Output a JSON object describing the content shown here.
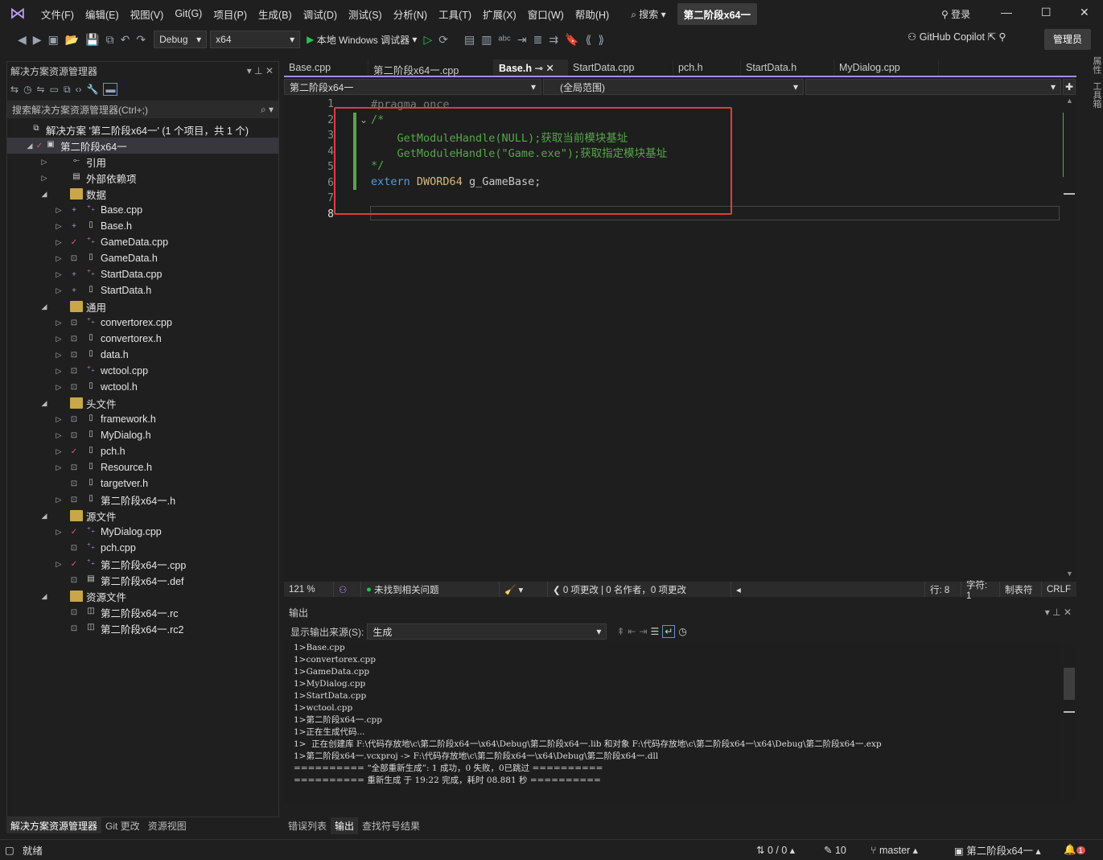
{
  "menu": {
    "items": [
      "文件(F)",
      "编辑(E)",
      "视图(V)",
      "Git(G)",
      "项目(P)",
      "生成(B)",
      "调试(D)",
      "测试(S)",
      "分析(N)",
      "工具(T)",
      "扩展(X)",
      "窗口(W)",
      "帮助(H)"
    ],
    "search": "搜索",
    "project": "第二阶段x64一",
    "login": "登录"
  },
  "toolbar": {
    "config": "Debug",
    "platform": "x64",
    "debugger": "本地 Windows 调试器",
    "copilot": "GitHub Copilot",
    "admin": "管理员"
  },
  "right_rail": {
    "properties": "属性",
    "toolbox": "工具箱"
  },
  "solution": {
    "title": "解决方案资源管理器",
    "search_placeholder": "搜索解决方案资源管理器(Ctrl+;)",
    "items": [
      {
        "label": "解决方案 '第二阶段x64一' (1 个项目，共 1 个)",
        "indent": 0,
        "arrow": "",
        "status": "",
        "icon": "solution"
      },
      {
        "label": "第二阶段x64一",
        "indent": 1,
        "arrow": "◢",
        "status": "✓",
        "icon": "project",
        "sel": true
      },
      {
        "label": "引用",
        "indent": 2,
        "arrow": "▷",
        "status": "",
        "icon": "ref"
      },
      {
        "label": "外部依赖项",
        "indent": 2,
        "arrow": "▷",
        "status": "",
        "icon": "ext"
      },
      {
        "label": "数据",
        "indent": 2,
        "arrow": "◢",
        "status": "",
        "icon": "folder"
      },
      {
        "label": "Base.cpp",
        "indent": 3,
        "arrow": "▷",
        "status": "+",
        "icon": "cpp"
      },
      {
        "label": "Base.h",
        "indent": 3,
        "arrow": "▷",
        "status": "+",
        "icon": "h"
      },
      {
        "label": "GameData.cpp",
        "indent": 3,
        "arrow": "▷",
        "status": "✓",
        "icon": "cpp"
      },
      {
        "label": "GameData.h",
        "indent": 3,
        "arrow": "▷",
        "status": "🔒",
        "icon": "h"
      },
      {
        "label": "StartData.cpp",
        "indent": 3,
        "arrow": "▷",
        "status": "+",
        "icon": "cpp"
      },
      {
        "label": "StartData.h",
        "indent": 3,
        "arrow": "▷",
        "status": "+",
        "icon": "h"
      },
      {
        "label": "通用",
        "indent": 2,
        "arrow": "◢",
        "status": "",
        "icon": "folder"
      },
      {
        "label": "convertorex.cpp",
        "indent": 3,
        "arrow": "▷",
        "status": "🔒",
        "icon": "cpp"
      },
      {
        "label": "convertorex.h",
        "indent": 3,
        "arrow": "▷",
        "status": "🔒",
        "icon": "h"
      },
      {
        "label": "data.h",
        "indent": 3,
        "arrow": "▷",
        "status": "🔒",
        "icon": "h"
      },
      {
        "label": "wctool.cpp",
        "indent": 3,
        "arrow": "▷",
        "status": "🔒",
        "icon": "cpp"
      },
      {
        "label": "wctool.h",
        "indent": 3,
        "arrow": "▷",
        "status": "🔒",
        "icon": "h"
      },
      {
        "label": "头文件",
        "indent": 2,
        "arrow": "◢",
        "status": "",
        "icon": "folder"
      },
      {
        "label": "framework.h",
        "indent": 3,
        "arrow": "▷",
        "status": "🔒",
        "icon": "h"
      },
      {
        "label": "MyDialog.h",
        "indent": 3,
        "arrow": "▷",
        "status": "🔒",
        "icon": "h"
      },
      {
        "label": "pch.h",
        "indent": 3,
        "arrow": "▷",
        "status": "✓",
        "icon": "h"
      },
      {
        "label": "Resource.h",
        "indent": 3,
        "arrow": "▷",
        "status": "🔒",
        "icon": "h"
      },
      {
        "label": "targetver.h",
        "indent": 3,
        "arrow": "",
        "status": "🔒",
        "icon": "h"
      },
      {
        "label": "第二阶段x64一.h",
        "indent": 3,
        "arrow": "▷",
        "status": "🔒",
        "icon": "h"
      },
      {
        "label": "源文件",
        "indent": 2,
        "arrow": "◢",
        "status": "",
        "icon": "folder"
      },
      {
        "label": "MyDialog.cpp",
        "indent": 3,
        "arrow": "▷",
        "status": "✓",
        "icon": "cpp"
      },
      {
        "label": "pch.cpp",
        "indent": 3,
        "arrow": "",
        "status": "🔒",
        "icon": "cpp"
      },
      {
        "label": "第二阶段x64一.cpp",
        "indent": 3,
        "arrow": "▷",
        "status": "✓",
        "icon": "cpp"
      },
      {
        "label": "第二阶段x64一.def",
        "indent": 3,
        "arrow": "",
        "status": "🔒",
        "icon": "def"
      },
      {
        "label": "资源文件",
        "indent": 2,
        "arrow": "◢",
        "status": "",
        "icon": "folder"
      },
      {
        "label": "第二阶段x64一.rc",
        "indent": 3,
        "arrow": "",
        "status": "🔒",
        "icon": "rc"
      },
      {
        "label": "第二阶段x64一.rc2",
        "indent": 3,
        "arrow": "",
        "status": "🔒",
        "icon": "rc"
      }
    ],
    "tabs": [
      "解决方案资源管理器",
      "Git 更改",
      "资源视图"
    ]
  },
  "editor": {
    "tabs": [
      "Base.cpp",
      "第二阶段x64一.cpp",
      "Base.h",
      "StartData.cpp",
      "pch.h",
      "StartData.h",
      "MyDialog.cpp"
    ],
    "active_tab": 2,
    "nav": {
      "project": "第二阶段x64一",
      "scope": "(全局范围)"
    },
    "lines": [
      "1",
      "2",
      "3",
      "4",
      "5",
      "6",
      "7",
      "8"
    ],
    "code": {
      "l1": "#pragma once",
      "l2": "/*",
      "l3": "    GetModuleHandle(NULL);获取当前模块基址",
      "l4": "    GetModuleHandle(\"Game.exe\");获取指定模块基址",
      "l5": "*/",
      "l6_kw": "extern",
      "l6_type": "DWORD64",
      "l6_rest": " g_GameBase;"
    },
    "status": {
      "zoom": "121 %",
      "issues": "未找到相关问题",
      "changes": "0 项更改 | 0 名作者，0 项更改",
      "line": "行: 8",
      "char": "字符: 1",
      "tabs": "制表符",
      "eol": "CRLF"
    }
  },
  "output": {
    "title": "输出",
    "source_label": "显示输出来源(S):",
    "source": "生成",
    "lines": [
      "1>Base.cpp",
      "1>convertorex.cpp",
      "1>GameData.cpp",
      "1>MyDialog.cpp",
      "1>StartData.cpp",
      "1>wctool.cpp",
      "1>第二阶段x64一.cpp",
      "1>正在生成代码...",
      "1>  正在创建库 F:\\代码存放地\\c\\第二阶段x64一\\x64\\Debug\\第二阶段x64一.lib 和对象 F:\\代码存放地\\c\\第二阶段x64一\\x64\\Debug\\第二阶段x64一.exp",
      "1>第二阶段x64一.vcxproj -> F:\\代码存放地\\c\\第二阶段x64一\\x64\\Debug\\第二阶段x64一.dll",
      "========== “全部重新生成”: 1 成功，0 失败，0已跳过 ==========",
      "========== 重新生成 于 19:22 完成，耗时 08.881 秒 =========="
    ],
    "tabs": [
      "错误列表",
      "输出",
      "查找符号结果"
    ]
  },
  "statusbar": {
    "ready": "就绪",
    "sync": "0 / 0",
    "edits": "10",
    "branch": "master",
    "project": "第二阶段x64一",
    "notify": "1"
  }
}
